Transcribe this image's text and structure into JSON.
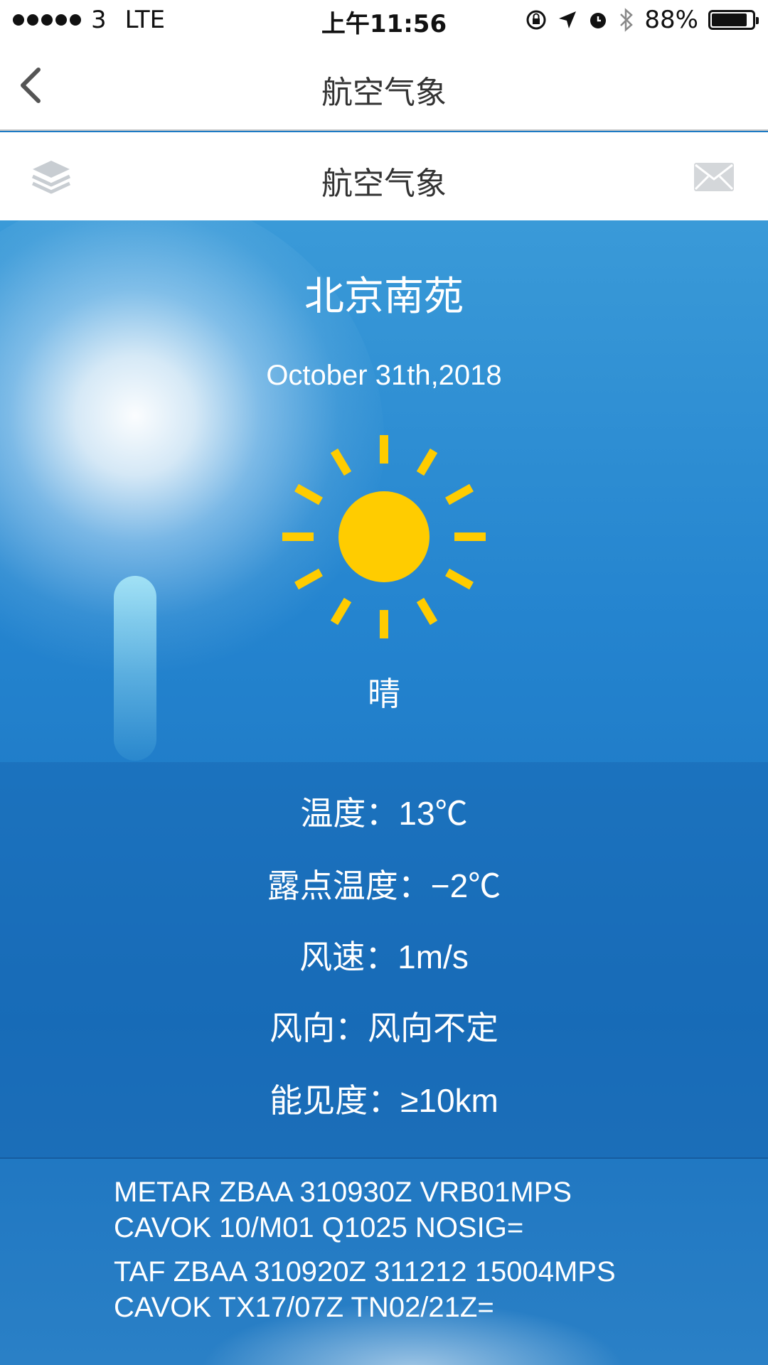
{
  "status_bar": {
    "carrier": "3",
    "network": "LTE",
    "time": "上午11:56",
    "battery_percent": "88%",
    "battery_level": 0.88
  },
  "nav": {
    "title": "航空气象",
    "back_icon": "chevron-left-icon"
  },
  "sub_header": {
    "title": "航空气象",
    "left_icon": "layers-icon",
    "right_icon": "mail-icon"
  },
  "weather": {
    "airport": "北京南苑",
    "date": "October  31th,2018",
    "condition_icon": "sun-icon",
    "condition": "晴",
    "details": {
      "temperature": "温度：13℃",
      "dew_point": "露点温度：−2℃",
      "wind_speed": "风速：1m/s",
      "wind_direction": "风向：风向不定",
      "visibility": "能见度：≥10km"
    },
    "reports": {
      "metar_line1": "METAR ZBAA 310930Z VRB01MPS",
      "metar_line2": "CAVOK 10/M01 Q1025 NOSIG=",
      "taf_line1": "TAF ZBAA 310920Z 311212 15004MPS",
      "taf_line2": "CAVOK TX17/07Z TN02/21Z="
    }
  },
  "colors": {
    "sky_top": "#3a9ad8",
    "sky_bottom": "#1a72bf",
    "sun": "#ffcc00",
    "header_bg": "#ffffff"
  }
}
